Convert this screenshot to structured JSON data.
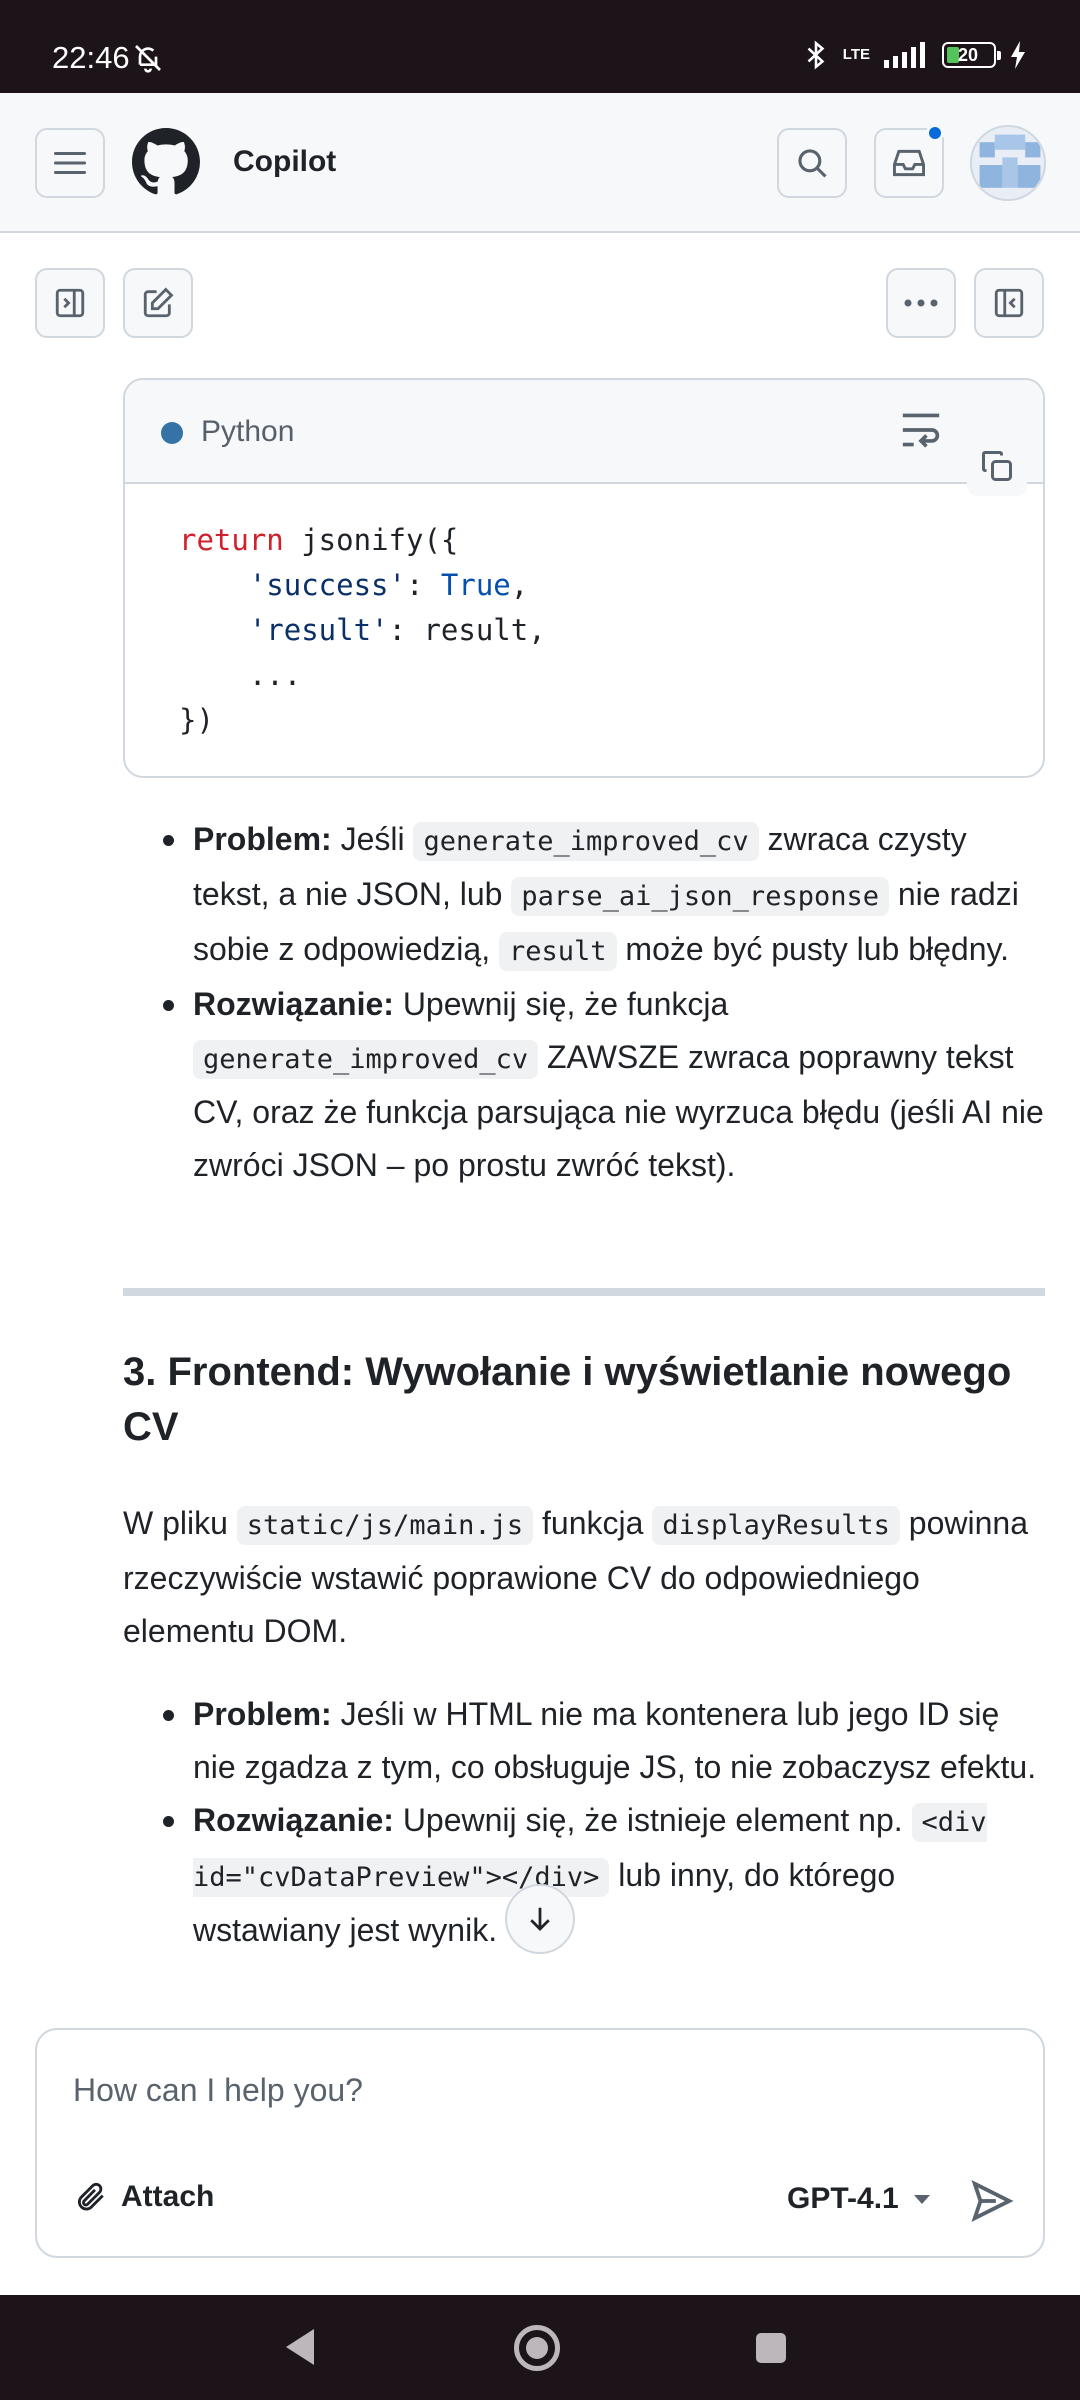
{
  "status_bar": {
    "time": "22:46",
    "network": "LTE",
    "battery": "20"
  },
  "header": {
    "title": "Copilot"
  },
  "code_block": {
    "language": "Python",
    "lines": {
      "l1_kw": "return",
      "l1_rest": " jsonify({",
      "l2_indent": "    ",
      "l2_key": "'success'",
      "l2_colon": ": ",
      "l2_val": "True",
      "l2_end": ",",
      "l3_indent": "    ",
      "l3_key": "'result'",
      "l3_rest": ": result,",
      "l4": "    ...",
      "l5": "})"
    }
  },
  "section1": {
    "bullets": [
      {
        "label": "Problem:",
        "t1": " Jeśli ",
        "c1": "generate_improved_cv",
        "t2": " zwraca czysty tekst, a nie JSON, lub ",
        "c2": "parse_ai_json_response",
        "t3": " nie radzi sobie z odpowiedzią, ",
        "c3": "result",
        "t4": " może być pusty lub błędny."
      },
      {
        "label": "Rozwiązanie:",
        "t1": " Upewnij się, że funkcja ",
        "c1": "generate_improved_cv",
        "t2": " ZAWSZE zwraca poprawny tekst CV, oraz że funkcja parsująca nie wyrzuca błędu (jeśli AI nie zwróci JSON – po prostu zwróć tekst)."
      }
    ]
  },
  "section3": {
    "heading": "3. Frontend: Wywołanie i wyświetlanie nowego CV",
    "para": {
      "t1": "W pliku ",
      "c1": "static/js/main.js",
      "t2": " funkcja ",
      "c2": "displayResults",
      "t3": " powinna rzeczywiście wstawić poprawione CV do odpowiedniego elementu DOM."
    },
    "bullets": [
      {
        "label": "Problem:",
        "t1": " Jeśli w HTML nie ma kontenera lub jego ID się nie zgadza z tym, co obsługuje JS, to nie zobaczysz efektu."
      },
      {
        "label": "Rozwiązanie:",
        "t1": " Upewnij się, że istnieje element np. ",
        "c1": "<div id=\"cvDataPreview\"></div>",
        "t2": " lub inny, do którego wstawiany jest wynik."
      }
    ]
  },
  "composer": {
    "placeholder": "How can I help you?",
    "attach_label": "Attach",
    "model": "GPT-4.1"
  }
}
